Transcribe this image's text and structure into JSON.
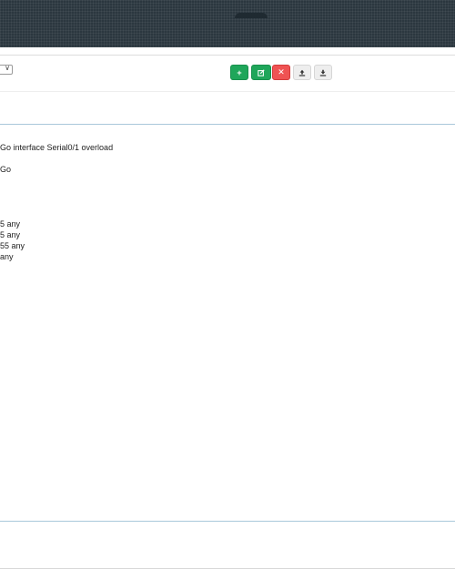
{
  "header": {
    "logo_notch": "header-notch"
  },
  "toolbar": {
    "add_label": "+",
    "edit_icon": "edit-icon",
    "delete_label": "✕",
    "upload_icon": "upload-icon",
    "download_icon": "download-icon"
  },
  "select": {
    "chevron": "∨"
  },
  "config_lines": [
    "Go interface Serial0/1 overload",
    "Go",
    "",
    "",
    "",
    "5 any",
    "5 any",
    "55 any",
    "any"
  ]
}
